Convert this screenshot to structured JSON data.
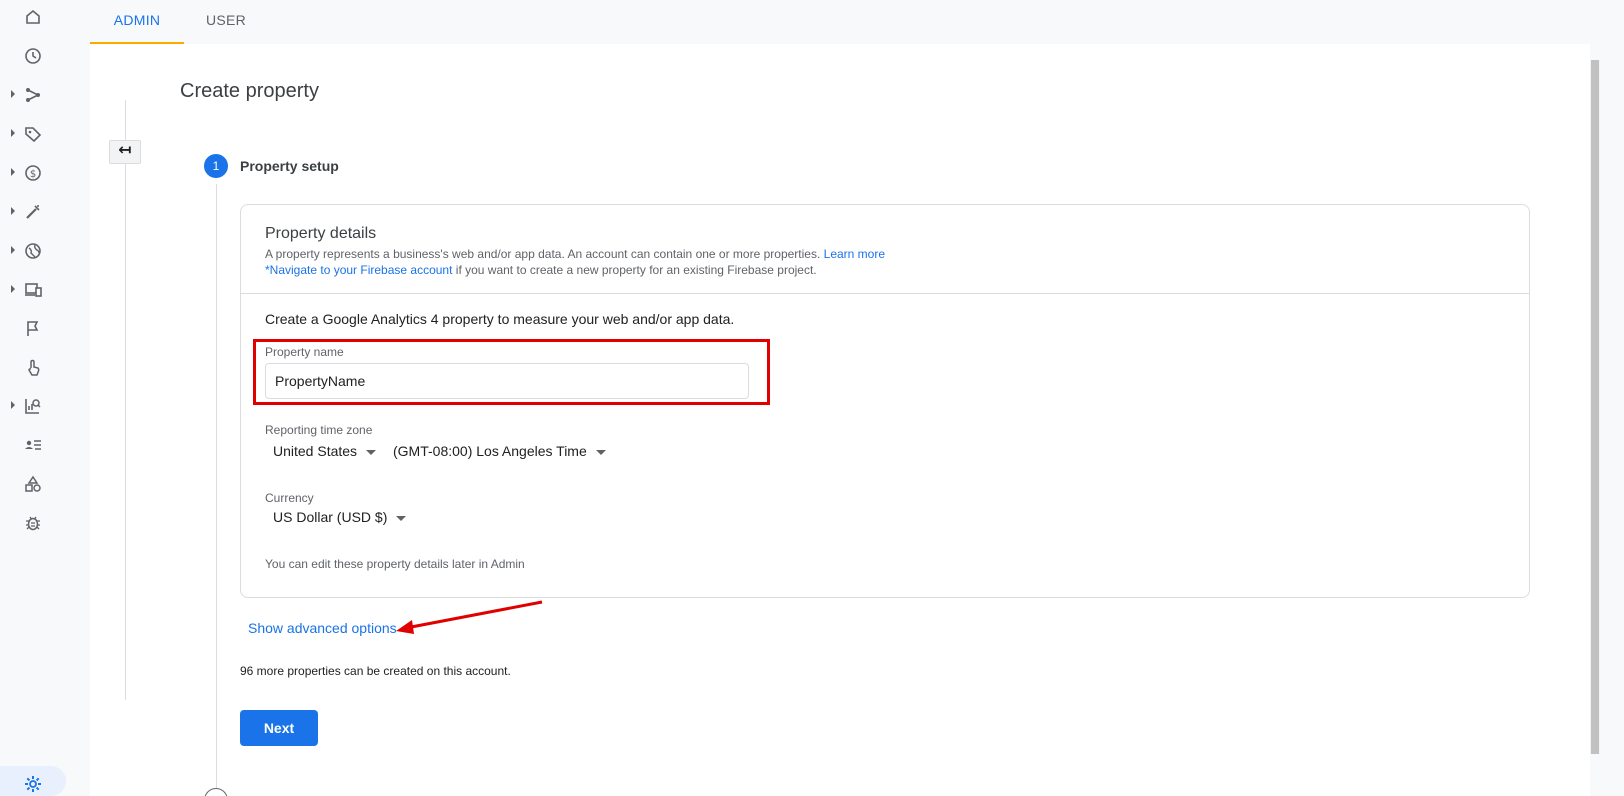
{
  "tabs": [
    {
      "label": "ADMIN",
      "active": true
    },
    {
      "label": "USER",
      "active": false
    }
  ],
  "rail": {
    "items": [
      {
        "icon": "home-icon",
        "has_caret": false
      },
      {
        "icon": "clock-icon",
        "has_caret": false
      },
      {
        "icon": "flow-icon",
        "has_caret": true
      },
      {
        "icon": "tag-icon",
        "has_caret": true
      },
      {
        "icon": "dollar-icon",
        "has_caret": true
      },
      {
        "icon": "wand-icon",
        "has_caret": true
      },
      {
        "icon": "globe-icon",
        "has_caret": true
      },
      {
        "icon": "devices-icon",
        "has_caret": true
      },
      {
        "icon": "flag-icon",
        "has_caret": false
      },
      {
        "icon": "touch-icon",
        "has_caret": false
      },
      {
        "icon": "report-search-icon",
        "has_caret": true
      },
      {
        "icon": "audience-icon",
        "has_caret": false
      },
      {
        "icon": "shapes-icon",
        "has_caret": false
      },
      {
        "icon": "bug-icon",
        "has_caret": false
      }
    ],
    "settings_icon": "gear-icon"
  },
  "page": {
    "title": "Create property",
    "back_glyph": "↤"
  },
  "step": {
    "number": "1",
    "title": "Property setup"
  },
  "details": {
    "title": "Property details",
    "desc_text": "A property represents a business's web and/or app data. An account can contain one or more properties.",
    "learn_more": "Learn more",
    "firebase_link": "*Navigate to your Firebase account",
    "firebase_text": "if you want to create a new property for an existing Firebase project.",
    "intro": "Create a Google Analytics 4 property to measure your web and/or app data.",
    "property_name_label": "Property name",
    "property_name_value": "PropertyName",
    "timezone_label": "Reporting time zone",
    "country": "United States",
    "timezone": "(GMT-08:00) Los Angeles Time",
    "currency_label": "Currency",
    "currency": "US Dollar (USD $)",
    "edit_note": "You can edit these property details later in Admin"
  },
  "advanced_link": "Show advanced options",
  "quota": "96 more properties can be created on this account.",
  "next_label": "Next",
  "colors": {
    "accent": "#1a73e8",
    "tab_indicator": "#f9ab00",
    "highlight": "#e00000"
  }
}
